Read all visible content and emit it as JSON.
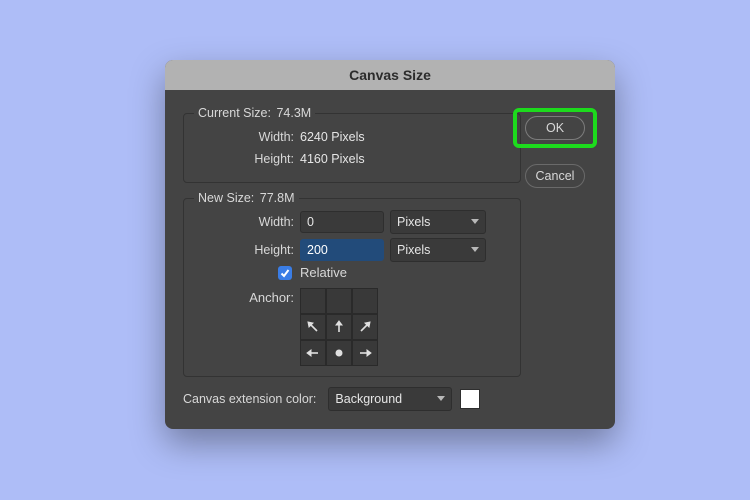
{
  "dialog": {
    "title": "Canvas Size",
    "ok_label": "OK",
    "cancel_label": "Cancel"
  },
  "current": {
    "legend_prefix": "Current Size:",
    "size_value": "74.3M",
    "width_label": "Width:",
    "width_value": "6240 Pixels",
    "height_label": "Height:",
    "height_value": "4160 Pixels"
  },
  "new": {
    "legend_prefix": "New Size:",
    "size_value": "77.8M",
    "width_label": "Width:",
    "width_value": "0",
    "height_label": "Height:",
    "height_value": "200",
    "unit": "Pixels",
    "relative_label": "Relative",
    "relative_checked": true,
    "anchor_label": "Anchor:"
  },
  "extension": {
    "label": "Canvas extension color:",
    "value": "Background",
    "swatch": "#ffffff"
  }
}
